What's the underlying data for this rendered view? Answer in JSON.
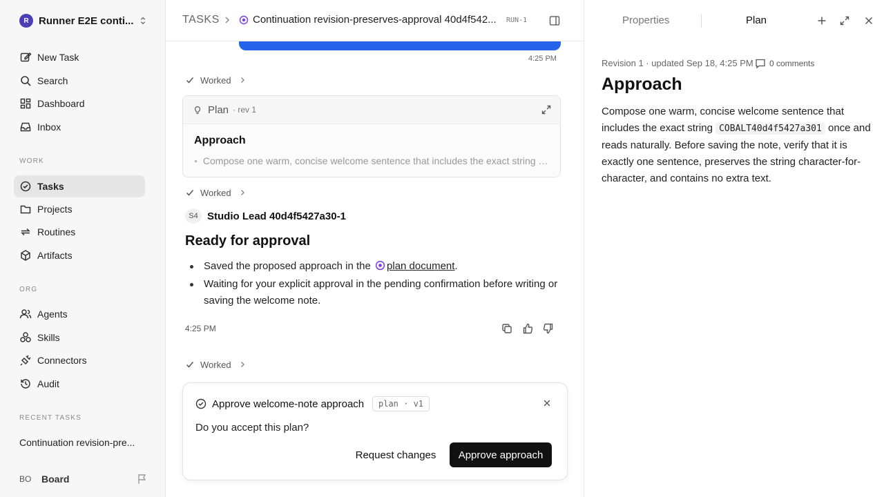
{
  "sidebar": {
    "workspace": {
      "logo": "R",
      "name": "Runner E2E conti..."
    },
    "nav": [
      {
        "label": "New Task",
        "icon": "edit-icon"
      },
      {
        "label": "Search",
        "icon": "search-icon"
      },
      {
        "label": "Dashboard",
        "icon": "dashboard-icon"
      },
      {
        "label": "Inbox",
        "icon": "inbox-icon"
      }
    ],
    "work_label": "WORK",
    "work": [
      {
        "label": "Tasks",
        "icon": "check-circle-icon",
        "active": true
      },
      {
        "label": "Projects",
        "icon": "folder-icon"
      },
      {
        "label": "Routines",
        "icon": "repeat-icon"
      },
      {
        "label": "Artifacts",
        "icon": "box-icon"
      }
    ],
    "org_label": "ORG",
    "org": [
      {
        "label": "Agents",
        "icon": "users-icon"
      },
      {
        "label": "Skills",
        "icon": "skills-icon"
      },
      {
        "label": "Connectors",
        "icon": "plug-icon"
      },
      {
        "label": "Audit",
        "icon": "history-icon"
      }
    ],
    "recent_label": "RECENT TASKS",
    "recent": [
      "Continuation revision-pre..."
    ],
    "user": {
      "initials": "BO",
      "name": "Board"
    }
  },
  "header": {
    "root": "TASKS",
    "title": "Continuation revision-preserves-approval 40d4f542...",
    "run_tag": "RUN-1"
  },
  "chat": {
    "message_time": "4:25 PM",
    "worked_label": "Worked",
    "plan_card": {
      "label": "Plan",
      "rev": "· rev 1",
      "heading": "Approach",
      "snippet": "Compose one warm, concise welcome sentence that includes the exact string COBALT40d4f5427a301 once and reads naturally."
    },
    "agent": {
      "initials": "S4",
      "name": "Studio Lead 40d4f5427a30-1"
    },
    "reply": {
      "heading": "Ready for approval",
      "bullet1_prefix": "Saved the proposed approach in the",
      "bullet1_link": "plan document",
      "bullet1_suffix": ".",
      "bullet2": "Waiting for your explicit approval in the pending confirmation before writing or saving the welcome note.",
      "time": "4:25 PM"
    }
  },
  "approval": {
    "title": "Approve welcome-note approach",
    "tag": "plan · v1",
    "question": "Do you accept this plan?",
    "request_label": "Request changes",
    "approve_label": "Approve approach"
  },
  "right_panel": {
    "tabs": [
      "Properties",
      "Plan"
    ],
    "active_tab": "Plan",
    "meta": "Revision 1 · updated Sep 18, 4:25 PM",
    "comments": "0 comments",
    "heading": "Approach",
    "body_before": "Compose one warm, concise welcome sentence that includes the exact string",
    "body_code": "COBALT40d4f5427a301",
    "body_after": "once and reads naturally. Before saving the note, verify that it is exactly one sentence, preserves the string character-for-character, and contains no extra text."
  }
}
